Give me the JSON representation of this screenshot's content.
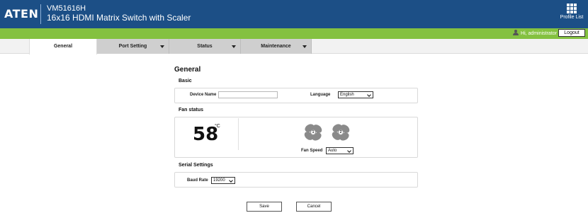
{
  "header": {
    "logo": "ATEN",
    "model": "VM51616H",
    "product": "16x16 HDMI Matrix Switch with Scaler",
    "profile_label": "Profile List"
  },
  "userbar": {
    "greeting": "Hi, administrator",
    "logout_label": "Logout"
  },
  "tabs": [
    {
      "label": "General",
      "active": true,
      "dropdown": false
    },
    {
      "label": "Port Setting",
      "active": false,
      "dropdown": true
    },
    {
      "label": "Status",
      "active": false,
      "dropdown": true
    },
    {
      "label": "Maintenance",
      "active": false,
      "dropdown": true
    }
  ],
  "page": {
    "title": "General",
    "basic": {
      "title": "Basic",
      "device_name_label": "Device Name",
      "device_name_value": "",
      "language_label": "Language",
      "language_value": "English"
    },
    "fan_status": {
      "title": "Fan status",
      "temperature": "58",
      "unit": "°C",
      "fans": [
        "1",
        "2"
      ],
      "fan_speed_label": "Fan Speed",
      "fan_speed_value": "Auto"
    },
    "serial": {
      "title": "Serial Settings",
      "baud_rate_label": "Baud Rate",
      "baud_rate_value": "19200"
    },
    "actions": {
      "save_label": "Save",
      "cancel_label": "Cancel"
    }
  },
  "colors": {
    "header": "#1c4f86",
    "accent": "#84c140"
  }
}
